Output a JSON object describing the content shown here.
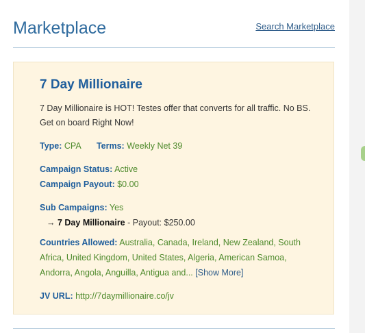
{
  "header": {
    "title": "Marketplace",
    "search_link": "Search Marketplace"
  },
  "offer": {
    "title": "7 Day Millionaire",
    "description": "7 Day Millionaire is HOT! Testes offer that converts for all traffic. No BS. Get on board Right Now!",
    "type_label": "Type:",
    "type_value": "CPA",
    "terms_label": "Terms:",
    "terms_value": "Weekly Net 39",
    "status_label": "Campaign Status:",
    "status_value": "Active",
    "payout_label": "Campaign Payout:",
    "payout_value": "$0.00",
    "sub_label": "Sub Campaigns:",
    "sub_value": "Yes",
    "sub_campaign": {
      "arrow": "→",
      "name": "7 Day Millionaire",
      "payout_text": "- Payout: $250.00"
    },
    "countries_label": "Countries Allowed:",
    "countries_value": "Australia, Canada, Ireland, New Zealand, South Africa, United Kingdom, United States, Algeria, American Samoa, Andorra, Angola, Anguilla, Antigua and...",
    "show_more": "[Show More]",
    "jv_label": "JV URL:",
    "jv_value": "http://7daymillionaire.co/jv"
  }
}
